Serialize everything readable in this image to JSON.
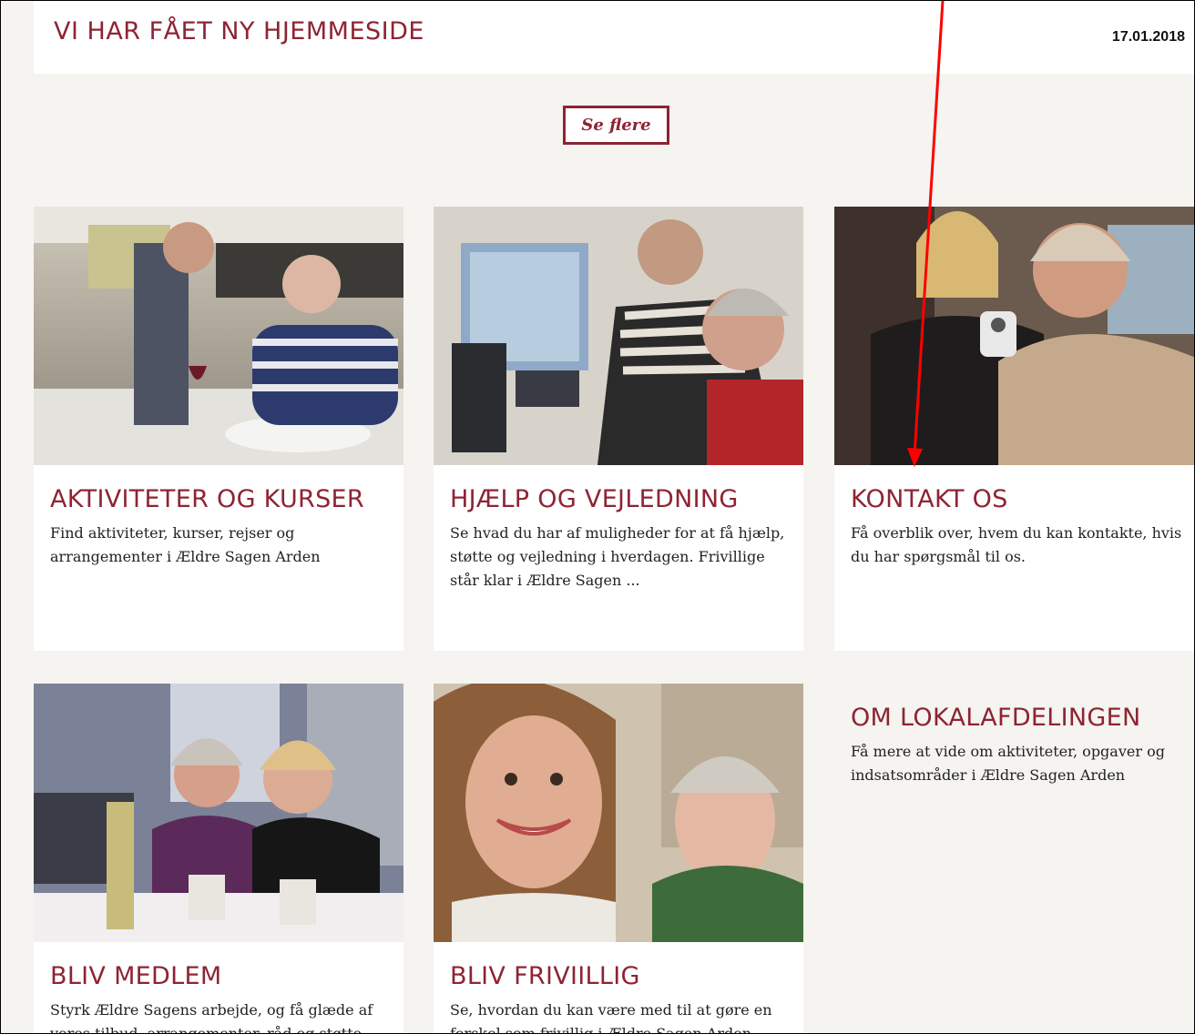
{
  "news": {
    "title": "VI HAR FÅET NY HJEMMESIDE",
    "date": "17.01.2018"
  },
  "see_more_label": "Se flere",
  "cards": [
    {
      "title": "AKTIVITETER OG KURSER",
      "text": "Find aktiviteter, kurser, rejser og arrangementer i Ældre Sagen Arden"
    },
    {
      "title": "HJÆLP OG VEJLEDNING",
      "text": "Se hvad du har af muligheder for at få hjælp, støtte og vejledning i hverdagen. Frivillige står klar i Ældre Sagen ..."
    },
    {
      "title": "KONTAKT OS",
      "text": "Få overblik over, hvem du kan kontakte, hvis du har spørgsmål til os."
    },
    {
      "title": "BLIV MEDLEM",
      "text": "Styrk Ældre Sagens arbejde, og få glæde af vores tilbud, arrangementer, råd og støtte."
    },
    {
      "title": "BLIV FRIVIILLIG",
      "text": "Se, hvordan du kan være med til at gøre en forskel som frivillig i Ældre Sagen Arden."
    },
    {
      "title": "OM LOKALAFDELINGEN",
      "text": "Få mere at vide om aktiviteter, opgaver og indsatsområder i Ældre Sagen Arden"
    }
  ],
  "colors": {
    "brand": "#8e2433",
    "page_bg": "#f5f4f0",
    "annotation_arrow": "#ff0000"
  }
}
